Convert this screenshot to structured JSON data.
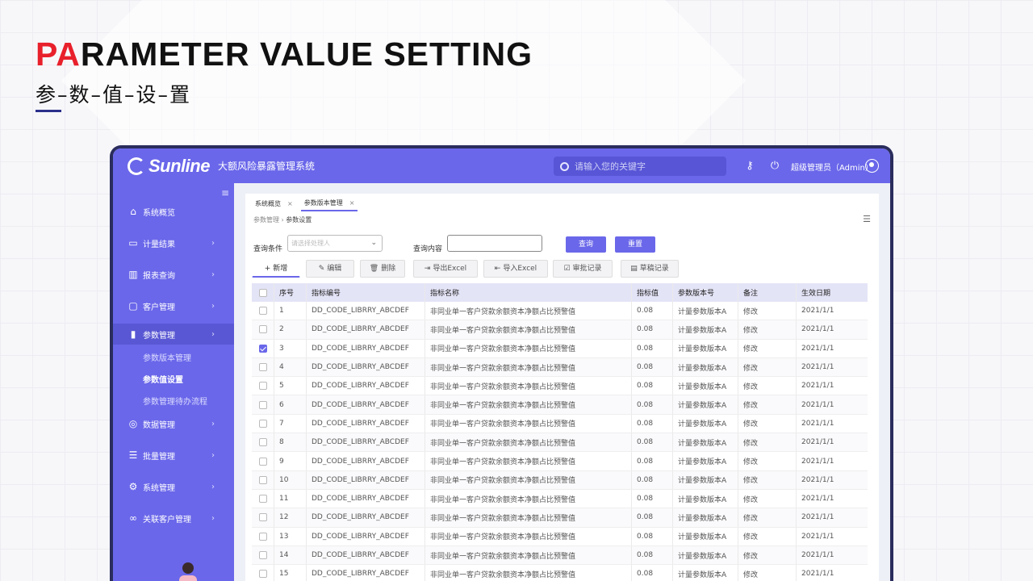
{
  "hero": {
    "title_accent": "PA",
    "title_rest": "RAMETER VALUE SETTING",
    "subtitle": "参–数–值–设–置"
  },
  "topbar": {
    "brand": "Sunline",
    "app_name": "大额风险暴露管理系统",
    "search_placeholder": "请输入您的关键字",
    "user": "超级管理员（Admin）"
  },
  "sidebar": {
    "items": [
      {
        "label": "系统概览",
        "icon": "home-icon"
      },
      {
        "label": "计量结果",
        "icon": "monitor-icon"
      },
      {
        "label": "报表查询",
        "icon": "bar-chart-icon"
      },
      {
        "label": "客户管理",
        "icon": "user-card-icon"
      },
      {
        "label": "参数管理",
        "icon": "signal-icon"
      },
      {
        "label": "数据管理",
        "icon": "data-icon"
      },
      {
        "label": "批量管理",
        "icon": "stack-icon"
      },
      {
        "label": "系统管理",
        "icon": "gear-icon"
      },
      {
        "label": "关联客户管理",
        "icon": "link-icon"
      }
    ],
    "sub_items": [
      "参数版本管理",
      "参数值设置",
      "参数管理待办流程"
    ]
  },
  "tabs": [
    {
      "label": "系统概览"
    },
    {
      "label": "参数版本管理"
    }
  ],
  "breadcrumb": {
    "parent": "参数管理",
    "current": "参数设置"
  },
  "filters": {
    "condition_label": "查询条件",
    "condition_placeholder": "请选择处理人",
    "content_label": "查询内容",
    "query_button": "查询",
    "reset_button": "重置"
  },
  "toolbar": {
    "add": "新增",
    "edit": "编辑",
    "delete": "删除",
    "export": "导出Excel",
    "import": "导入Excel",
    "approval": "审批记录",
    "draft": "草稿记录"
  },
  "table": {
    "headers": [
      "序号",
      "指标编号",
      "指标名称",
      "指标值",
      "参数版本号",
      "备注",
      "生效日期"
    ],
    "rows": [
      {
        "seq": "1",
        "code": "DD_CODE_LIBRRY_ABCDEF",
        "name": "非同业单一客户贷款余额资本净额占比预警值",
        "value": "0.08",
        "version": "计量参数版本A",
        "note": "修改",
        "date": "2021/1/1",
        "checked": false
      },
      {
        "seq": "2",
        "code": "DD_CODE_LIBRRY_ABCDEF",
        "name": "非同业单一客户贷款余额资本净额占比预警值",
        "value": "0.08",
        "version": "计量参数版本A",
        "note": "修改",
        "date": "2021/1/1",
        "checked": false
      },
      {
        "seq": "3",
        "code": "DD_CODE_LIBRRY_ABCDEF",
        "name": "非同业单一客户贷款余额资本净额占比预警值",
        "value": "0.08",
        "version": "计量参数版本A",
        "note": "修改",
        "date": "2021/1/1",
        "checked": true
      },
      {
        "seq": "4",
        "code": "DD_CODE_LIBRRY_ABCDEF",
        "name": "非同业单一客户贷款余额资本净额占比预警值",
        "value": "0.08",
        "version": "计量参数版本A",
        "note": "修改",
        "date": "2021/1/1",
        "checked": false
      },
      {
        "seq": "5",
        "code": "DD_CODE_LIBRRY_ABCDEF",
        "name": "非同业单一客户贷款余额资本净额占比预警值",
        "value": "0.08",
        "version": "计量参数版本A",
        "note": "修改",
        "date": "2021/1/1",
        "checked": false
      },
      {
        "seq": "6",
        "code": "DD_CODE_LIBRRY_ABCDEF",
        "name": "非同业单一客户贷款余额资本净额占比预警值",
        "value": "0.08",
        "version": "计量参数版本A",
        "note": "修改",
        "date": "2021/1/1",
        "checked": false
      },
      {
        "seq": "7",
        "code": "DD_CODE_LIBRRY_ABCDEF",
        "name": "非同业单一客户贷款余额资本净额占比预警值",
        "value": "0.08",
        "version": "计量参数版本A",
        "note": "修改",
        "date": "2021/1/1",
        "checked": false
      },
      {
        "seq": "8",
        "code": "DD_CODE_LIBRRY_ABCDEF",
        "name": "非同业单一客户贷款余额资本净额占比预警值",
        "value": "0.08",
        "version": "计量参数版本A",
        "note": "修改",
        "date": "2021/1/1",
        "checked": false
      },
      {
        "seq": "9",
        "code": "DD_CODE_LIBRRY_ABCDEF",
        "name": "非同业单一客户贷款余额资本净额占比预警值",
        "value": "0.08",
        "version": "计量参数版本A",
        "note": "修改",
        "date": "2021/1/1",
        "checked": false
      },
      {
        "seq": "10",
        "code": "DD_CODE_LIBRRY_ABCDEF",
        "name": "非同业单一客户贷款余额资本净额占比预警值",
        "value": "0.08",
        "version": "计量参数版本A",
        "note": "修改",
        "date": "2021/1/1",
        "checked": false
      },
      {
        "seq": "11",
        "code": "DD_CODE_LIBRRY_ABCDEF",
        "name": "非同业单一客户贷款余额资本净额占比预警值",
        "value": "0.08",
        "version": "计量参数版本A",
        "note": "修改",
        "date": "2021/1/1",
        "checked": false
      },
      {
        "seq": "12",
        "code": "DD_CODE_LIBRRY_ABCDEF",
        "name": "非同业单一客户贷款余额资本净额占比预警值",
        "value": "0.08",
        "version": "计量参数版本A",
        "note": "修改",
        "date": "2021/1/1",
        "checked": false
      },
      {
        "seq": "13",
        "code": "DD_CODE_LIBRRY_ABCDEF",
        "name": "非同业单一客户贷款余额资本净额占比预警值",
        "value": "0.08",
        "version": "计量参数版本A",
        "note": "修改",
        "date": "2021/1/1",
        "checked": false
      },
      {
        "seq": "14",
        "code": "DD_CODE_LIBRRY_ABCDEF",
        "name": "非同业单一客户贷款余额资本净额占比预警值",
        "value": "0.08",
        "version": "计量参数版本A",
        "note": "修改",
        "date": "2021/1/1",
        "checked": false
      },
      {
        "seq": "15",
        "code": "DD_CODE_LIBRRY_ABCDEF",
        "name": "非同业单一客户贷款余额资本净额占比预警值",
        "value": "0.08",
        "version": "计量参数版本A",
        "note": "修改",
        "date": "2021/1/1",
        "checked": false
      }
    ]
  },
  "colors": {
    "accent": "#6a67ea",
    "title_red": "#e8202b"
  }
}
